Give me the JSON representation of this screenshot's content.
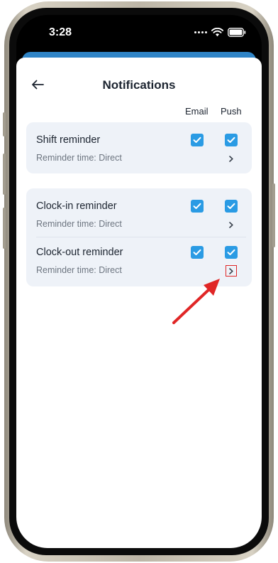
{
  "status_bar": {
    "time": "3:28"
  },
  "header": {
    "title": "Notifications"
  },
  "columns": {
    "email": "Email",
    "push": "Push"
  },
  "cards": [
    {
      "rows": [
        {
          "label": "Shift reminder",
          "sub": "Reminder time: Direct",
          "email_checked": true,
          "push_checked": true
        }
      ]
    },
    {
      "rows": [
        {
          "label": "Clock-in reminder",
          "sub": "Reminder time: Direct",
          "email_checked": true,
          "push_checked": true
        },
        {
          "label": "Clock-out reminder",
          "sub": "Reminder time: Direct",
          "email_checked": true,
          "push_checked": true
        }
      ]
    }
  ],
  "colors": {
    "accent": "#2a9be4",
    "annotation": "#e02626",
    "header_band": "#2f84c6"
  },
  "icons": {
    "back": "arrow-left-icon",
    "chevron": "chevron-right-icon",
    "check": "checkmark-icon",
    "wifi": "wifi-icon",
    "battery": "battery-icon",
    "signal": "signal-dots-icon"
  }
}
